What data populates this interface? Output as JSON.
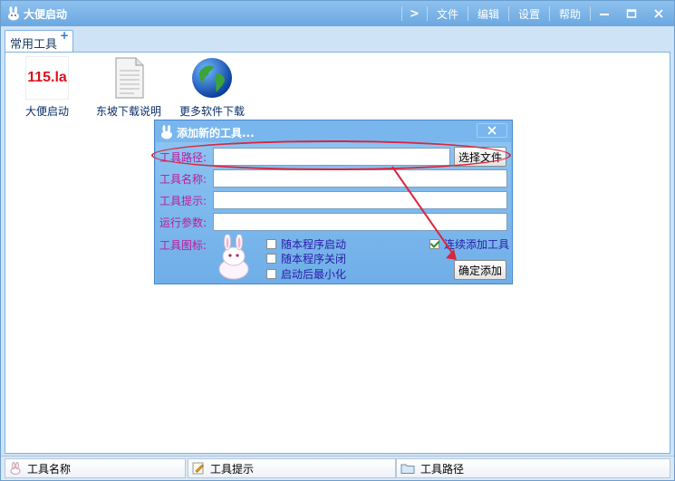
{
  "window": {
    "title": "大便启动"
  },
  "menu": {
    "file": "文件",
    "edit": "编辑",
    "settings": "设置",
    "help": "帮助"
  },
  "tabs": [
    {
      "label": "常用工具",
      "add": "+"
    }
  ],
  "tools": [
    {
      "label": "大便启动",
      "icon": "115-logo-icon",
      "logo_text": "115.la"
    },
    {
      "label": "东坡下载说明",
      "icon": "document-icon"
    },
    {
      "label": "更多软件下载",
      "icon": "globe-icon"
    }
  ],
  "dialog": {
    "title": "添加新的工具...",
    "fields": {
      "path_label": "工具路径:",
      "name_label": "工具名称:",
      "hint_label": "工具提示:",
      "args_label": "运行参数:",
      "icon_label": "工具图标:"
    },
    "path_value": "",
    "name_value": "",
    "hint_value": "",
    "args_value": "",
    "choose_file_button": "选择文件",
    "confirm_button": "确定添加",
    "checkboxes": [
      {
        "label": "随本程序启动",
        "checked": false
      },
      {
        "label": "随本程序关闭",
        "checked": false
      },
      {
        "label": "启动后最小化",
        "checked": false
      },
      {
        "label": "连续添加工具",
        "checked": true
      }
    ]
  },
  "status": {
    "col1": "工具名称",
    "col2": "工具提示",
    "col3": "工具路径"
  },
  "colors": {
    "title_bar": "#6aa7e0",
    "label": "#c0189a",
    "annotation": "#d9263b"
  }
}
